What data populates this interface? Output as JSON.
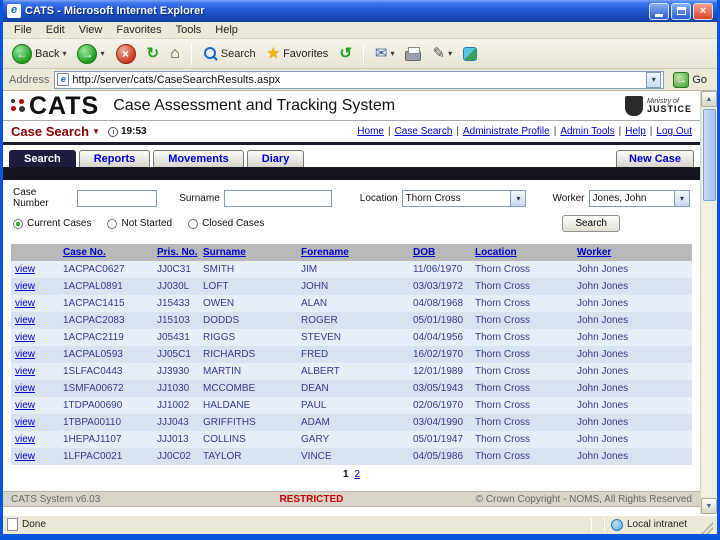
{
  "window": {
    "title": "CATS - Microsoft Internet Explorer",
    "menu": [
      "File",
      "Edit",
      "View",
      "Favorites",
      "Tools",
      "Help"
    ],
    "toolbar": {
      "back": "Back",
      "search": "Search",
      "favorites": "Favorites"
    },
    "address": {
      "label": "Address",
      "value": "http://server/cats/CaseSearchResults.aspx",
      "go": "Go"
    },
    "status": {
      "left": "Done",
      "zone": "Local intranet"
    }
  },
  "icons": {
    "back_arrow": "←",
    "forward_arrow": "→",
    "stop": "×",
    "refresh": "↻",
    "home": "⌂",
    "star": "★",
    "history": "↺",
    "mail": "✉",
    "edit": "✎",
    "dropdown": "▾",
    "caret": "▼",
    "close": "×",
    "go_arrow": "→",
    "scroll_up": "▲",
    "scroll_down": "▼"
  },
  "header": {
    "logo": "CATS",
    "title": "Case Assessment and Tracking System",
    "moj_top": "Ministry of",
    "moj_bottom": "JUSTICE"
  },
  "subheader": {
    "title": "Case Search",
    "time": "19:53",
    "separator": "|",
    "links": [
      "Home",
      "Case Search",
      "Administrate Profile",
      "Admin Tools",
      "Help",
      "Log Out"
    ]
  },
  "tabs": {
    "items": [
      "Search",
      "Reports",
      "Movements",
      "Diary"
    ],
    "new_case": "New Case"
  },
  "form": {
    "case_number_label": "Case Number",
    "surname_label": "Surname",
    "location_label": "Location",
    "location_value": "Thorn Cross",
    "worker_label": "Worker",
    "worker_value": "Jones, John",
    "search_button": "Search",
    "radios": [
      {
        "label": "Current Cases",
        "checked": true
      },
      {
        "label": "Not Started",
        "checked": false
      },
      {
        "label": "Closed Cases",
        "checked": false
      }
    ]
  },
  "table": {
    "view_label": "view",
    "columns": [
      "Case No.",
      "Pris. No.",
      "Surname",
      "Forename",
      "DOB",
      "Location",
      "Worker"
    ],
    "rows": [
      [
        "1ACPAC0627",
        "JJ0C31",
        "SMITH",
        "JIM",
        "11/06/1970",
        "Thorn Cross",
        "John Jones"
      ],
      [
        "1ACPAL0891",
        "JJ030L",
        "LOFT",
        "JOHN",
        "03/03/1972",
        "Thorn Cross",
        "John Jones"
      ],
      [
        "1ACPAC1415",
        "J15433",
        "OWEN",
        "ALAN",
        "04/08/1968",
        "Thorn Cross",
        "John Jones"
      ],
      [
        "1ACPAC2083",
        "J15103",
        "DODDS",
        "ROGER",
        "05/01/1980",
        "Thorn Cross",
        "John Jones"
      ],
      [
        "1ACPAC2119",
        "J05431",
        "RIGGS",
        "STEVEN",
        "04/04/1956",
        "Thorn Cross",
        "John Jones"
      ],
      [
        "1ACPAL0593",
        "JJ05C1",
        "RICHARDS",
        "FRED",
        "16/02/1970",
        "Thorn Cross",
        "John Jones"
      ],
      [
        "1SLFAC0443",
        "JJ3930",
        "MARTIN",
        "ALBERT",
        "12/01/1989",
        "Thorn Cross",
        "John Jones"
      ],
      [
        "1SMFA00672",
        "JJ1030",
        "MCCOMBE",
        "DEAN",
        "03/05/1943",
        "Thorn Cross",
        "John Jones"
      ],
      [
        "1TDPA00690",
        "JJ1002",
        "HALDANE",
        "PAUL",
        "02/06/1970",
        "Thorn Cross",
        "John Jones"
      ],
      [
        "1TBPA00110",
        "JJJ043",
        "GRIFFITHS",
        "ADAM",
        "03/04/1990",
        "Thorn Cross",
        "John Jones"
      ],
      [
        "1HEPAJ1107",
        "JJJ013",
        "COLLINS",
        "GARY",
        "05/01/1947",
        "Thorn Cross",
        "John Jones"
      ],
      [
        "1LFPAC0021",
        "JJ0C02",
        "TAYLOR",
        "VINCE",
        "04/05/1986",
        "Thorn Cross",
        "John Jones"
      ]
    ]
  },
  "pagination": {
    "current": "1",
    "next": "2"
  },
  "footer": {
    "left": "CATS System v6.03",
    "center": "RESTRICTED",
    "right": "© Crown Copyright - NOMS, All Rights Reserved"
  }
}
